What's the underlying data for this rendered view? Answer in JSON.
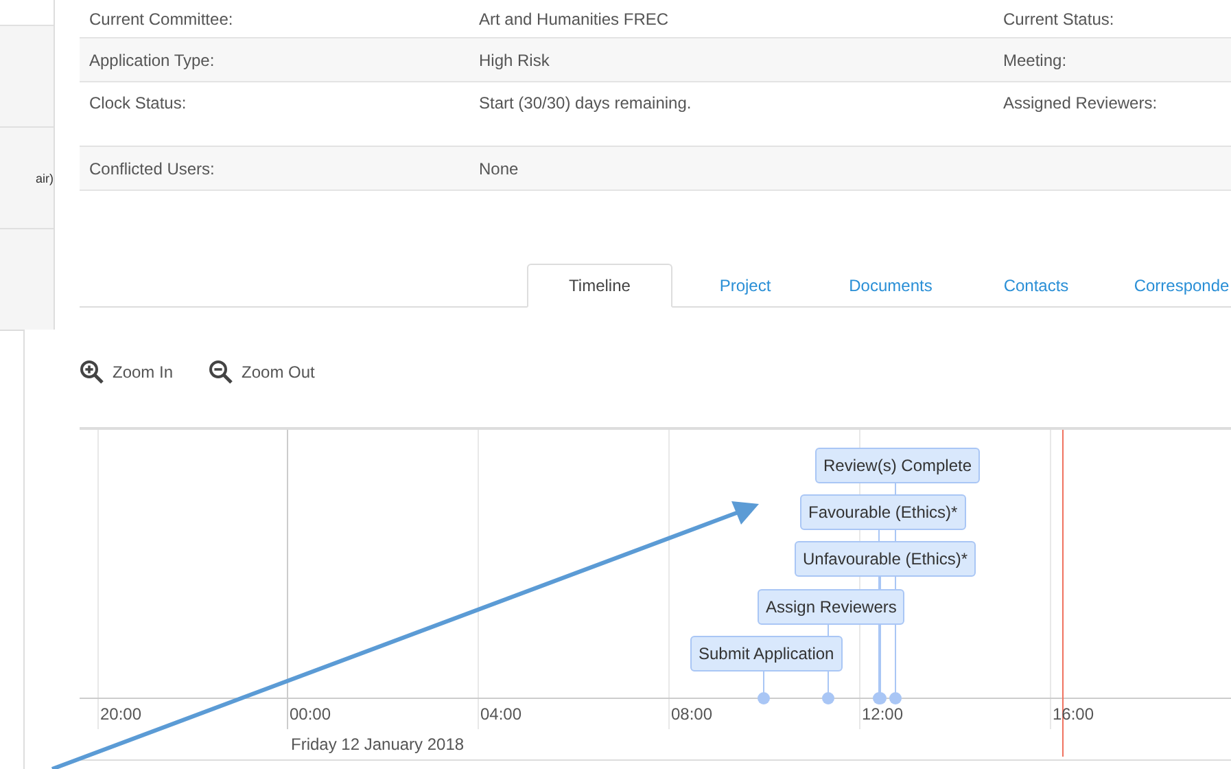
{
  "sidebar": {
    "cells": [
      {
        "text": ""
      },
      {
        "text": "air)"
      },
      {
        "text": ""
      }
    ]
  },
  "details": {
    "rows": [
      {
        "label": "Current Committee:",
        "value": "Art and Humanities FREC",
        "label_2": "Current Status:"
      },
      {
        "label": "Application Type:",
        "value": "High Risk",
        "label_2": "Meeting:"
      },
      {
        "label": "Clock Status:",
        "value": "Start (30/30) days remaining.",
        "label_2": "Assigned Reviewers:"
      },
      {
        "label": "Conflicted Users:",
        "value": "None"
      }
    ]
  },
  "tabs": [
    {
      "label": "Timeline",
      "selected": true
    },
    {
      "label": "Project",
      "selected": false
    },
    {
      "label": "Documents",
      "selected": false
    },
    {
      "label": "Contacts",
      "selected": false
    },
    {
      "label": "Corresponde",
      "selected": false
    }
  ],
  "toolbar": [
    {
      "kind": "zoom-in",
      "label": "Zoom In"
    },
    {
      "kind": "zoom-out",
      "label": "Zoom Out"
    }
  ],
  "timeline": {
    "ticks": [
      "20:00",
      "00:00",
      "04:00",
      "08:00",
      "12:00",
      "16:00"
    ],
    "date": "Friday 12 January 2018",
    "events": [
      {
        "label": "Review(s) Complete"
      },
      {
        "label": "Favourable (Ethics)*"
      },
      {
        "label": "Unfavourable (Ethics)*"
      },
      {
        "label": "Assign Reviewers"
      },
      {
        "label": "Submit Application"
      }
    ]
  }
}
